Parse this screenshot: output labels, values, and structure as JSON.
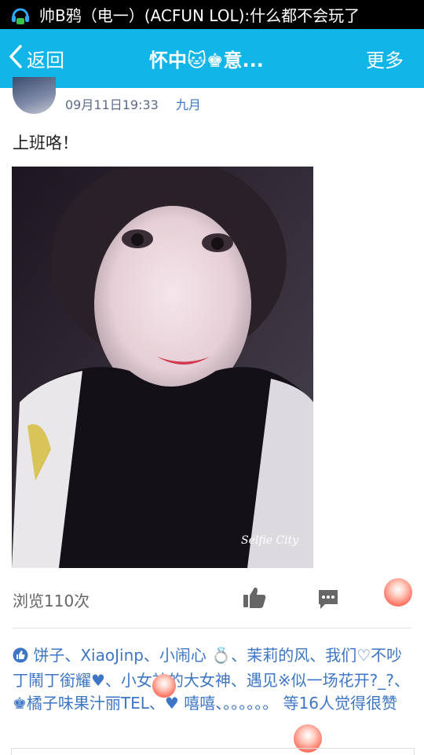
{
  "status_bar": {
    "notification": "帅B鸦（电一）(ACFUN LOL):什么都不会玩了",
    "icon": "headset-icon"
  },
  "nav": {
    "back_label": "返回",
    "title": "怀中🐱♚意...",
    "more_label": "更多"
  },
  "post": {
    "date": "09月11日19:33",
    "month_tag": "九月",
    "text": "上班咯！",
    "photo_caption": "Selfie City",
    "views": "浏览110次"
  },
  "actions": {
    "like_icon": "thumbs-up-icon",
    "comment_icon": "comment-icon",
    "likes_icon": "like-circle-icon"
  },
  "likes": {
    "names": "饼子、XiaoJinp、小闹心 💍、茉莉的风、我们♡不吵丁鬧丁銜耀♥、小女神的大女神、遇见※似一场花开?_?、♚橘子味果汁丽TEL、♥ 嘻嘻、。。。。。。",
    "summary": "等16人觉得很赞"
  }
}
